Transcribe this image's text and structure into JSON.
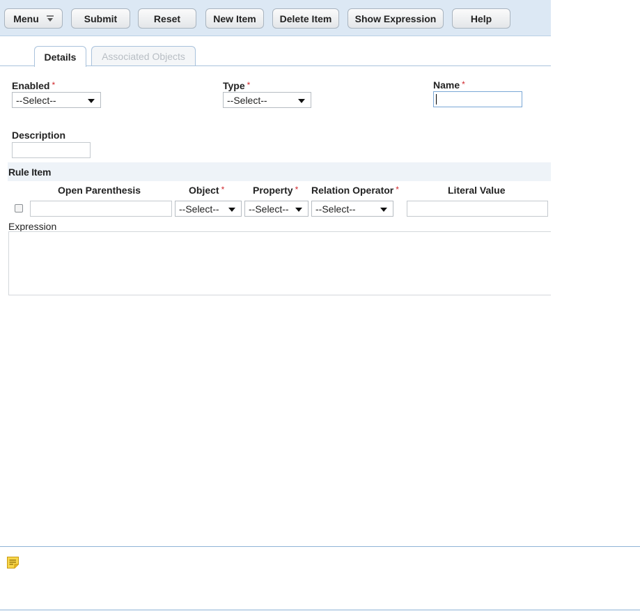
{
  "toolbar": {
    "menu": "Menu",
    "submit": "Submit",
    "reset": "Reset",
    "new_item": "New Item",
    "delete_item": "Delete Item",
    "show_expression": "Show Expression",
    "help": "Help"
  },
  "tabs": [
    {
      "label": "Details",
      "active": true
    },
    {
      "label": "Associated Objects",
      "active": false
    }
  ],
  "form": {
    "enabled": {
      "label": "Enabled",
      "value": "--Select--"
    },
    "type": {
      "label": "Type",
      "value": "--Select--"
    },
    "name": {
      "label": "Name",
      "value": ""
    },
    "description": {
      "label": "Description",
      "value": ""
    },
    "required_marker": "*"
  },
  "rule_item": {
    "title": "Rule Item",
    "columns": {
      "open_parenthesis": "Open Parenthesis",
      "object": "Object",
      "property": "Property",
      "relation_operator": "Relation Operator",
      "literal_value": "Literal Value"
    },
    "row": {
      "checked": false,
      "open_parenthesis": "",
      "object": "--Select--",
      "property": "--Select--",
      "relation_operator": "--Select--",
      "literal_value": ""
    }
  },
  "expression": {
    "label": "Expression",
    "value": ""
  },
  "note": {
    "icon": "note-icon"
  },
  "colors": {
    "toolbar_bg": "#dce8f4",
    "required": "#d0262b",
    "tab_border": "#a9c2dc",
    "note_icon": "#f2c12e"
  }
}
